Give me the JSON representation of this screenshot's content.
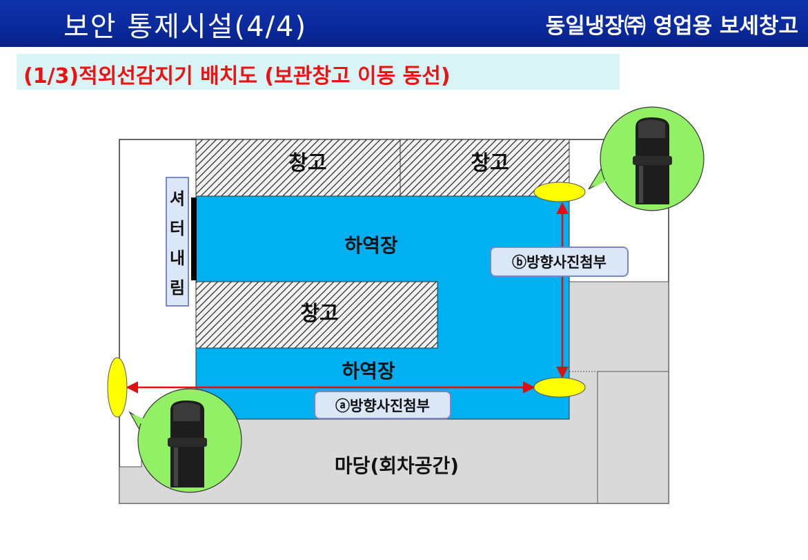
{
  "header": {
    "title": "보안 통제시설(4/4)",
    "company": "동일냉장㈜ 영업용 보세창고"
  },
  "subtitle": "(1/3)적외선감지기 배치도 (보관창고 이동 동선)",
  "rooms": {
    "warehouse_top_left": "창고",
    "warehouse_top_right": "창고",
    "warehouse_middle": "창고",
    "loading_top": "하역장",
    "loading_bottom": "하역장",
    "yard": "마당(회차공간)"
  },
  "shutter": {
    "chars": [
      "셔",
      "터",
      "내",
      "림"
    ]
  },
  "directions": {
    "a": "ⓐ방향사진첨부",
    "b": "ⓑ방향사진첨부"
  },
  "colors": {
    "header": "#0a2a9c",
    "subtitle_bg": "#d8f4f6",
    "subtitle_text": "#ee1111",
    "loading": "#00b0f0",
    "yard": "#d9d9d9",
    "callout": "#92f065",
    "sensor": "#ffff00",
    "arrow": "#dd1111"
  }
}
